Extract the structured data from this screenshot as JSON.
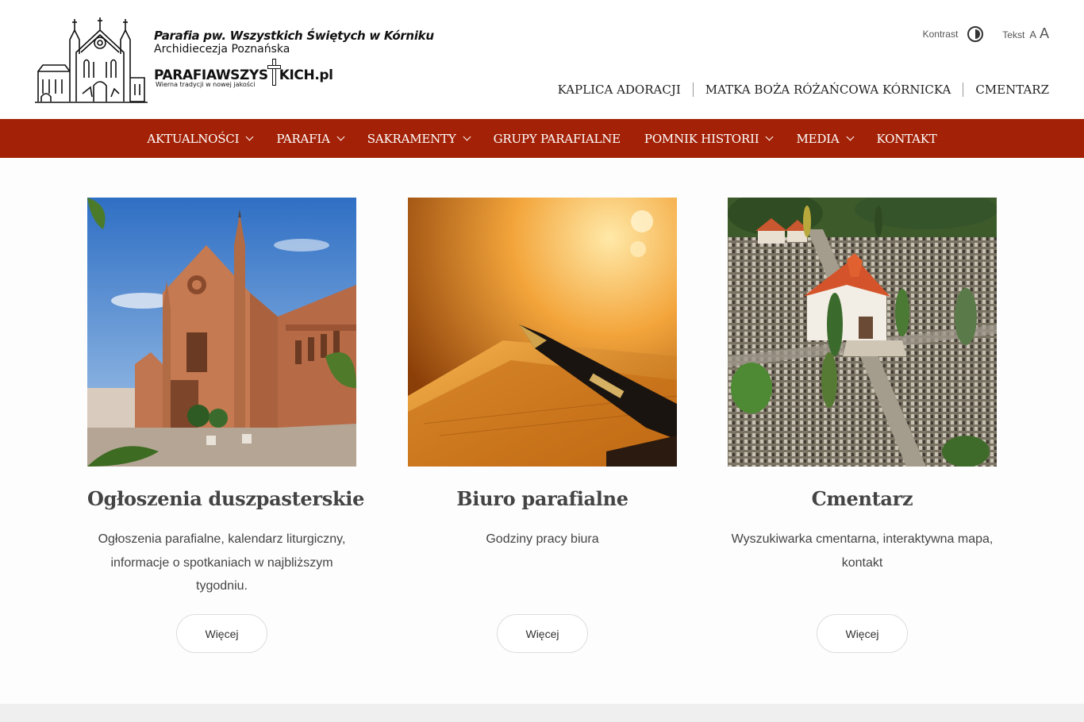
{
  "header": {
    "logo": {
      "title": "Parafia pw. Wszystkich Świętych w Kórniku",
      "subtitle": "Archidiecezja Poznańska",
      "brand_left": "PARAFIAWSZYS",
      "brand_right": "KICH.pl",
      "tagline": "Wierna tradycji w nowej jakości"
    },
    "tools": {
      "contrast_label": "Kontrast",
      "text_label": "Tekst",
      "font_small": "A",
      "font_big": "A"
    },
    "toplinks": [
      "KAPLICA ADORACJI",
      "MATKA BOŻA RÓŻAŃCOWA KÓRNICKA",
      "CMENTARZ"
    ]
  },
  "nav": {
    "items": [
      {
        "label": "AKTUALNOŚCI",
        "dropdown": true
      },
      {
        "label": "PARAFIA",
        "dropdown": true
      },
      {
        "label": "SAKRAMENTY",
        "dropdown": true
      },
      {
        "label": "GRUPY PARAFIALNE",
        "dropdown": false
      },
      {
        "label": "POMNIK HISTORII",
        "dropdown": true
      },
      {
        "label": "MEDIA",
        "dropdown": true
      },
      {
        "label": "KONTAKT",
        "dropdown": false
      }
    ]
  },
  "cards": [
    {
      "image": "church-photo",
      "title": "Ogłoszenia duszpasterskie",
      "description": "Ogłoszenia parafialne, kalendarz liturgiczny, informacje o spotkaniach w najbliższym tygodniu.",
      "button": "Więcej"
    },
    {
      "image": "fountain-pen-photo",
      "title": "Biuro parafialne",
      "description": "Godziny pracy biura",
      "button": "Więcej"
    },
    {
      "image": "cemetery-aerial-photo",
      "title": "Cmentarz",
      "description": "Wyszukiwarka cmentarna, interaktywna mapa, kontakt",
      "button": "Więcej"
    }
  ],
  "colors": {
    "nav_background": "#a32207",
    "nav_text": "#ffffff",
    "page_background": "#fdfdfd"
  }
}
